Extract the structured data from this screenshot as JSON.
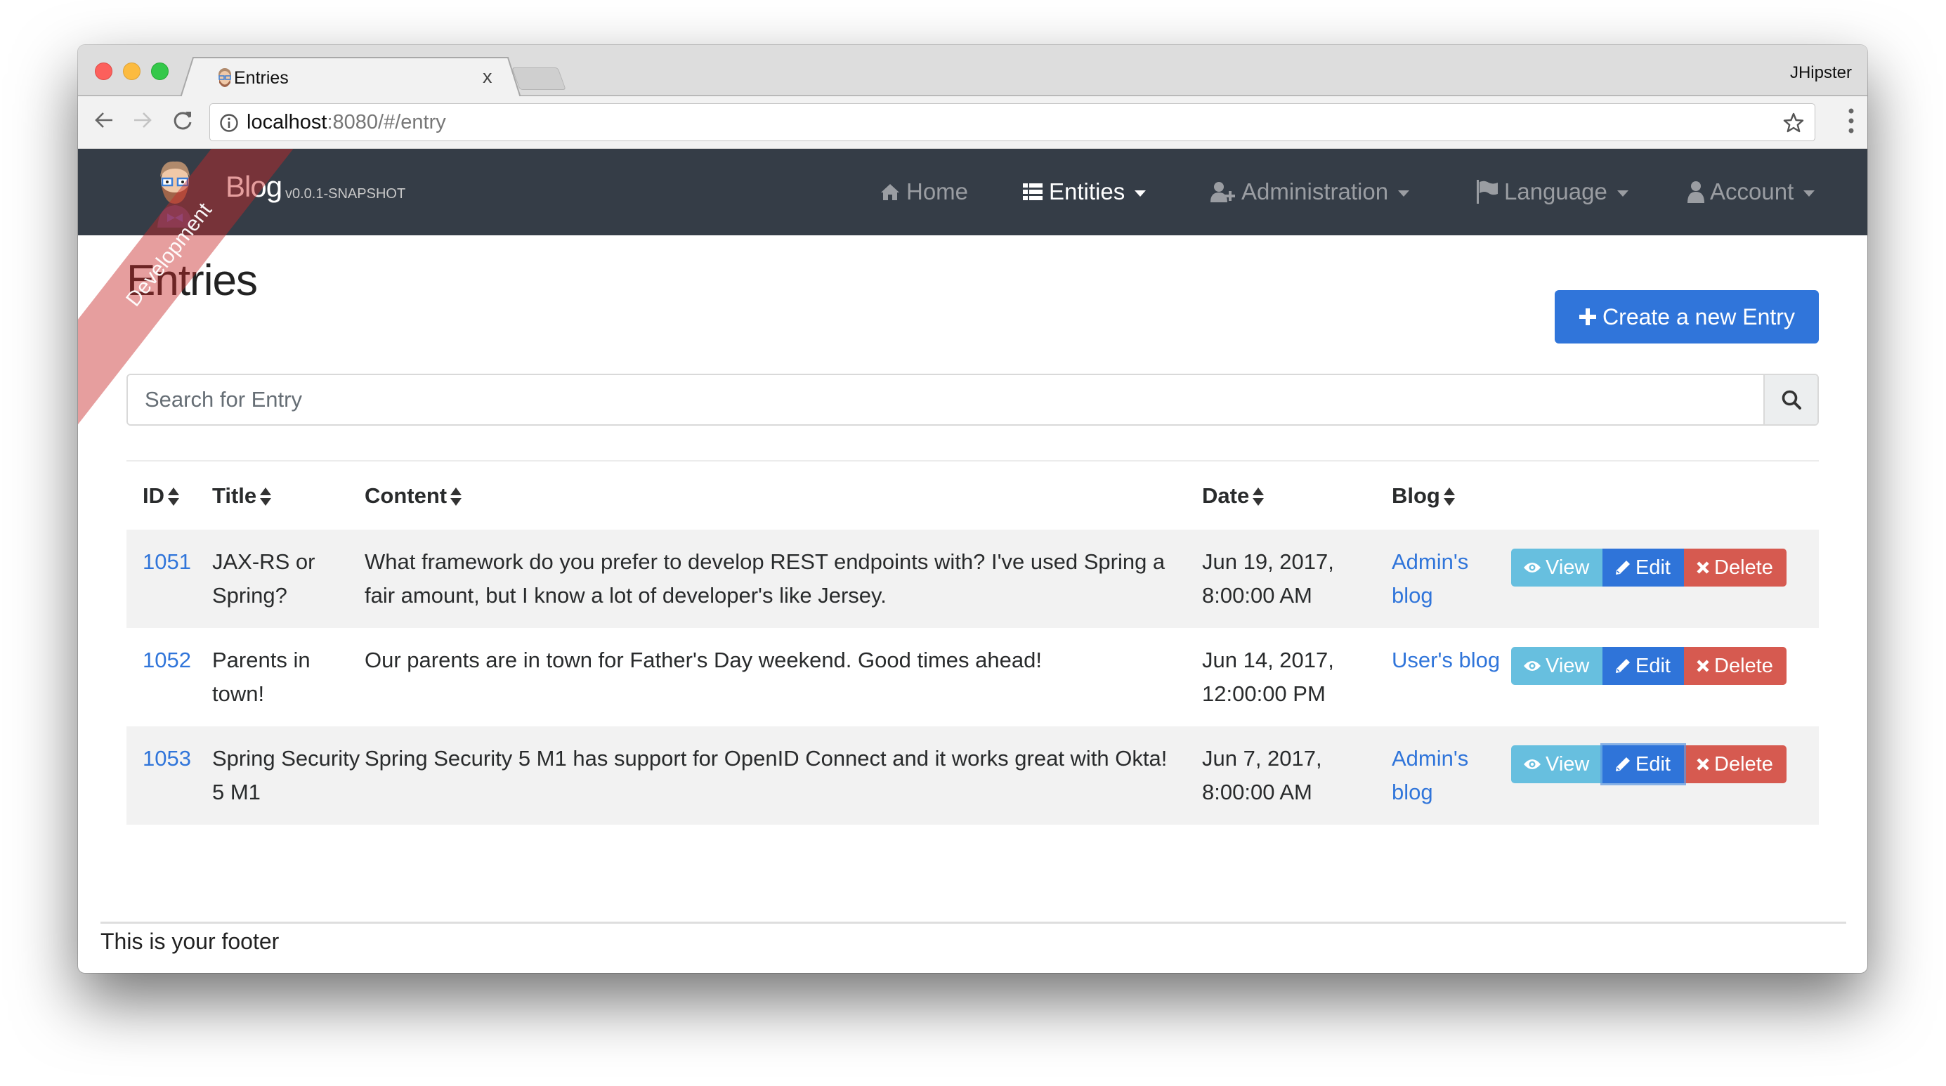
{
  "browser": {
    "tab_title": "Entries",
    "tab_close": "x",
    "profile_name": "JHipster",
    "url_host": "localhost",
    "url_rest": ":8080/#/entry"
  },
  "navbar": {
    "brand": "Blog",
    "version": "v0.0.1-SNAPSHOT",
    "ribbon": "Development",
    "items": [
      {
        "label": "Home",
        "icon": "home-icon",
        "active": false,
        "dropdown": false
      },
      {
        "label": "Entities",
        "icon": "list-icon",
        "active": true,
        "dropdown": true
      },
      {
        "label": "Administration",
        "icon": "user-plus-icon",
        "active": false,
        "dropdown": true
      },
      {
        "label": "Language",
        "icon": "flag-icon",
        "active": false,
        "dropdown": true
      },
      {
        "label": "Account",
        "icon": "user-icon",
        "active": false,
        "dropdown": true
      }
    ]
  },
  "page": {
    "title": "Entries",
    "create_button": "Create a new Entry",
    "search_placeholder": "Search for Entry"
  },
  "table": {
    "columns": [
      "ID",
      "Title",
      "Content",
      "Date",
      "Blog"
    ],
    "actions": {
      "view": "View",
      "edit": "Edit",
      "delete": "Delete"
    },
    "rows": [
      {
        "id": "1051",
        "title": "JAX-RS or Spring?",
        "content": "What framework do you prefer to develop REST endpoints with? I've used Spring a fair amount, but I know a lot of developer's like Jersey.",
        "date_line1": "Jun 19, 2017,",
        "date_line2": "8:00:00 AM",
        "blog": "Admin's blog"
      },
      {
        "id": "1052",
        "title": "Parents in town!",
        "content": "Our parents are in town for Father's Day weekend. Good times ahead!",
        "date_line1": "Jun 14, 2017,",
        "date_line2": "12:00:00 PM",
        "blog": "User's blog"
      },
      {
        "id": "1053",
        "title": "Spring Security 5 M1",
        "content": "Spring Security 5 M1 has support for OpenID Connect and it works great with Okta!",
        "date_line1": "Jun 7, 2017,",
        "date_line2": "8:00:00 AM",
        "blog": "Admin's blog"
      }
    ]
  },
  "footer": {
    "text": "This is your footer"
  },
  "colors": {
    "navbar_bg": "#353d47",
    "primary": "#3075da",
    "info": "#67bfdf",
    "danger": "#d65a50",
    "row_stripe": "#f2f2f2"
  }
}
